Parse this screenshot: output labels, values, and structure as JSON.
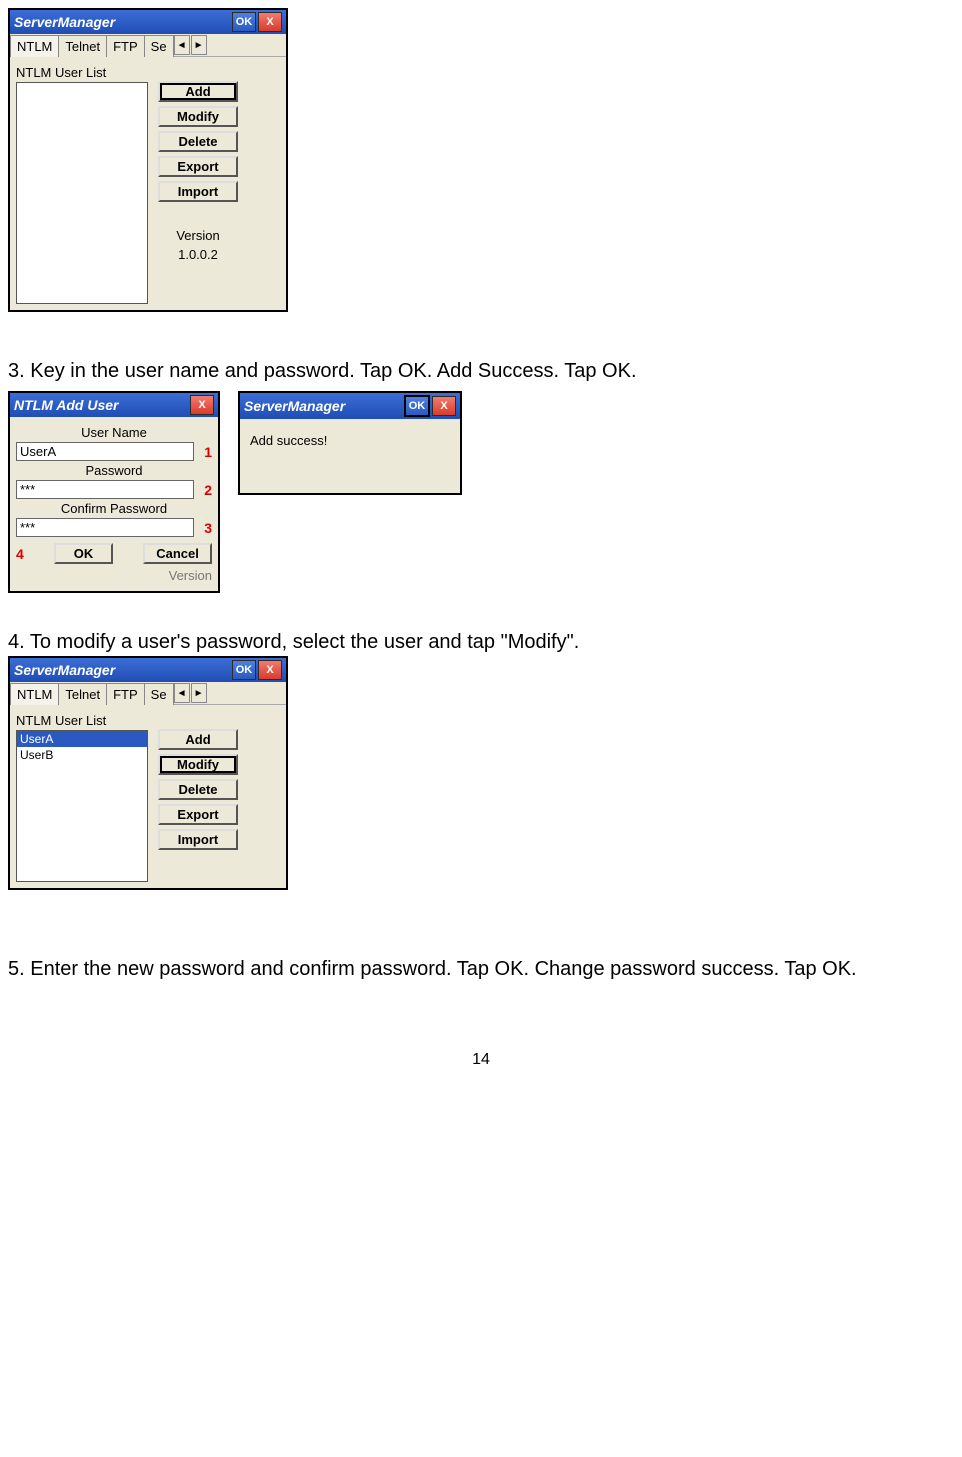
{
  "page_number": "14",
  "step3_text": "3. Key in the user name and password. Tap OK. Add Success. Tap OK.",
  "step4_text": "4. To modify a user's password, select the user and tap \"Modify\".",
  "step5_text": "5. Enter the new password and confirm password. Tap OK. Change password success. Tap OK.",
  "fig1": {
    "title": "ServerManager",
    "ok": "OK",
    "close": "X",
    "tabs": [
      "NTLM",
      "Telnet",
      "FTP",
      "Se"
    ],
    "list_label": "NTLM User List",
    "buttons": [
      "Add",
      "Modify",
      "Delete",
      "Export",
      "Import"
    ],
    "version_line1": "Version",
    "version_line2": "1.0.0.2"
  },
  "fig2": {
    "title": "NTLM Add User",
    "close": "X",
    "user_label": "User Name",
    "user_value": "UserA",
    "pw_label": "Password",
    "pw_value": "***",
    "confirm_label": "Confirm Password",
    "confirm_value": "***",
    "ok_label": "OK",
    "cancel_label": "Cancel",
    "n1": "1",
    "n2": "2",
    "n3": "3",
    "n4": "4",
    "vers": "Version"
  },
  "fig3": {
    "title": "ServerManager",
    "ok": "OK",
    "close": "X",
    "msg": "Add success!"
  },
  "fig4": {
    "title": "ServerManager",
    "ok": "OK",
    "close": "X",
    "tabs": [
      "NTLM",
      "Telnet",
      "FTP",
      "Se"
    ],
    "list_label": "NTLM User List",
    "user_a": "UserA",
    "user_b": "UserB",
    "buttons": [
      "Add",
      "Modify",
      "Delete",
      "Export",
      "Import"
    ]
  }
}
